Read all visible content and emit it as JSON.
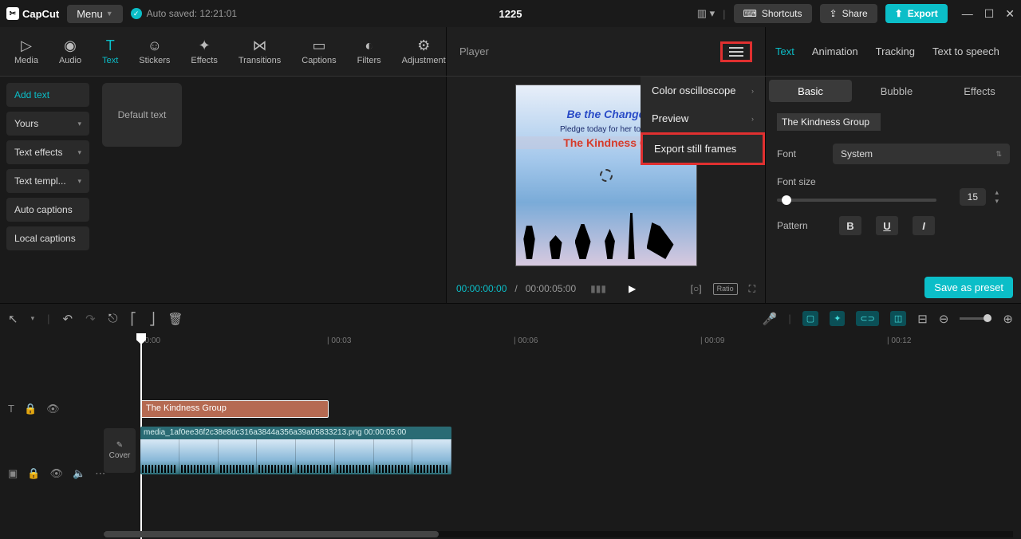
{
  "app": {
    "name": "CapCut"
  },
  "titlebar": {
    "menu": "Menu",
    "autosave": "Auto saved: 12:21:01",
    "project": "1225",
    "shortcuts": "Shortcuts",
    "share": "Share",
    "export": "Export"
  },
  "tabs": {
    "media": "Media",
    "audio": "Audio",
    "text": "Text",
    "stickers": "Stickers",
    "effects": "Effects",
    "transitions": "Transitions",
    "captions": "Captions",
    "filters": "Filters",
    "adjustment": "Adjustment"
  },
  "sidebar": {
    "add_text": "Add text",
    "yours": "Yours",
    "text_effects": "Text effects",
    "text_templ": "Text templ...",
    "auto_captions": "Auto captions",
    "local_captions": "Local captions",
    "default_text": "Default text"
  },
  "player": {
    "label": "Player",
    "menu": {
      "color_osc": "Color oscilloscope",
      "preview": "Preview",
      "export_frames": "Export still frames"
    },
    "time_cur": "00:00:00:00",
    "time_dur": "00:00:05:00",
    "ratio": "Ratio",
    "preview": {
      "line1": "Be the Change",
      "line2": "Pledge today for her tomo",
      "line3": "The Kindness G"
    }
  },
  "right_tabs": {
    "text": "Text",
    "animation": "Animation",
    "tracking": "Tracking",
    "tts": "Text to speech"
  },
  "sub_tabs": {
    "basic": "Basic",
    "bubble": "Bubble",
    "effects": "Effects"
  },
  "props": {
    "text_value": "The Kindness Group",
    "font_label": "Font",
    "font_value": "System",
    "size_label": "Font size",
    "size_value": "15",
    "pattern_label": "Pattern",
    "save_preset": "Save as preset"
  },
  "timeline": {
    "marks": [
      "00:00",
      "| 00:03",
      "| 00:06",
      "| 00:09",
      "| 00:12"
    ],
    "text_clip": "The Kindness Group",
    "media_clip": "media_1af0ee36f2c38e8dc316a3844a356a39a05833213.png   00:00:05:00",
    "cover": "Cover"
  }
}
